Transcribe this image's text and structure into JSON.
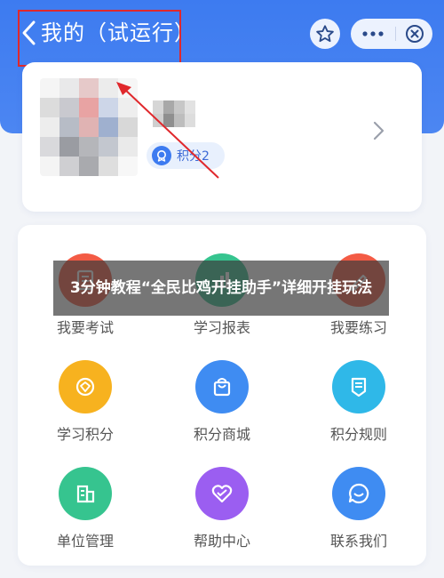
{
  "header": {
    "title": "我的（试运行）",
    "colors": {
      "background": "#3d7bf0",
      "annotation_red": "#e0282c"
    }
  },
  "profile": {
    "points_label": "积分2"
  },
  "grid": {
    "items": [
      {
        "label": "我要考试",
        "icon": "exam-icon",
        "color": "#f35b45"
      },
      {
        "label": "学习报表",
        "icon": "report-icon",
        "color": "#36c48f"
      },
      {
        "label": "我要练习",
        "icon": "practice-icon",
        "color": "#f35b45"
      },
      {
        "label": "学习积分",
        "icon": "medal-icon",
        "color": "#f7b21f"
      },
      {
        "label": "积分商城",
        "icon": "shopping-bag-icon",
        "color": "#3f8cf2"
      },
      {
        "label": "积分规则",
        "icon": "rules-icon",
        "color": "#2fb8e8"
      },
      {
        "label": "单位管理",
        "icon": "building-icon",
        "color": "#36c48f"
      },
      {
        "label": "帮助中心",
        "icon": "heart-handshake-icon",
        "color": "#9b5ef1"
      },
      {
        "label": "联系我们",
        "icon": "chat-icon",
        "color": "#3f8cf2"
      }
    ]
  },
  "overlay": {
    "caption": "3分钟教程“全民比鸡开挂助手”详细开挂玩法"
  }
}
